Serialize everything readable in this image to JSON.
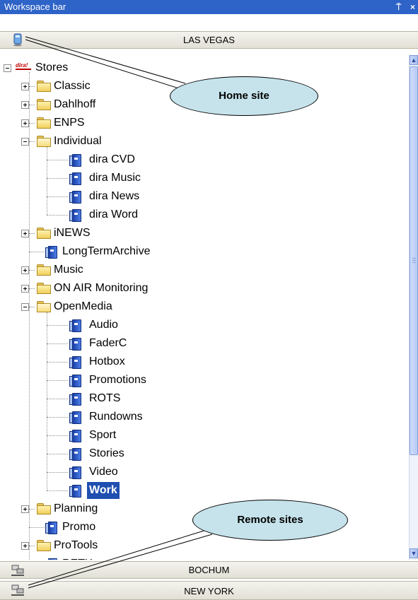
{
  "window": {
    "title": "Workspace bar",
    "pin_glyph": "⍑",
    "close_glyph": "×"
  },
  "home_site": {
    "name": "LAS VEGAS",
    "icon": "server-icon"
  },
  "remote_sites": [
    {
      "name": "BOCHUM",
      "icon": "network-server-icon"
    },
    {
      "name": "NEW YORK",
      "icon": "network-server-icon"
    }
  ],
  "tree": {
    "root": {
      "label": "Stores",
      "icon": "dira-logo-icon",
      "expanded": true
    },
    "items": [
      {
        "label": "Classic",
        "type": "folder",
        "expanded": false
      },
      {
        "label": "Dahlhoff",
        "type": "folder",
        "expanded": false
      },
      {
        "label": "ENPS",
        "type": "folder",
        "expanded": false
      },
      {
        "label": "Individual",
        "type": "folder",
        "expanded": true,
        "children": [
          "dira CVD",
          "dira Music",
          "dira News",
          "dira Word"
        ]
      },
      {
        "label": "iNEWS",
        "type": "folder",
        "expanded": false
      },
      {
        "label": "LongTermArchive",
        "type": "store"
      },
      {
        "label": "Music",
        "type": "folder",
        "expanded": false
      },
      {
        "label": "ON AIR Monitoring",
        "type": "folder",
        "expanded": false
      },
      {
        "label": "OpenMedia",
        "type": "folder",
        "expanded": true,
        "children": [
          "Audio",
          "FaderC",
          "Hotbox",
          "Promotions",
          "ROTS",
          "Rundowns",
          "Sport",
          "Stories",
          "Video",
          "Work"
        ]
      },
      {
        "label": "Planning",
        "type": "folder",
        "expanded": false
      },
      {
        "label": "Promo",
        "type": "store"
      },
      {
        "label": "ProTools",
        "type": "folder",
        "expanded": false
      },
      {
        "label": "RETX",
        "type": "store"
      }
    ],
    "selected": "Work"
  },
  "annotations": {
    "home_site_label": "Home site",
    "remote_sites_label": "Remote sites"
  },
  "colors": {
    "titlebar": "#2e63c8",
    "callout_fill": "#c6e3ec",
    "selection": "#1f4fb0"
  }
}
